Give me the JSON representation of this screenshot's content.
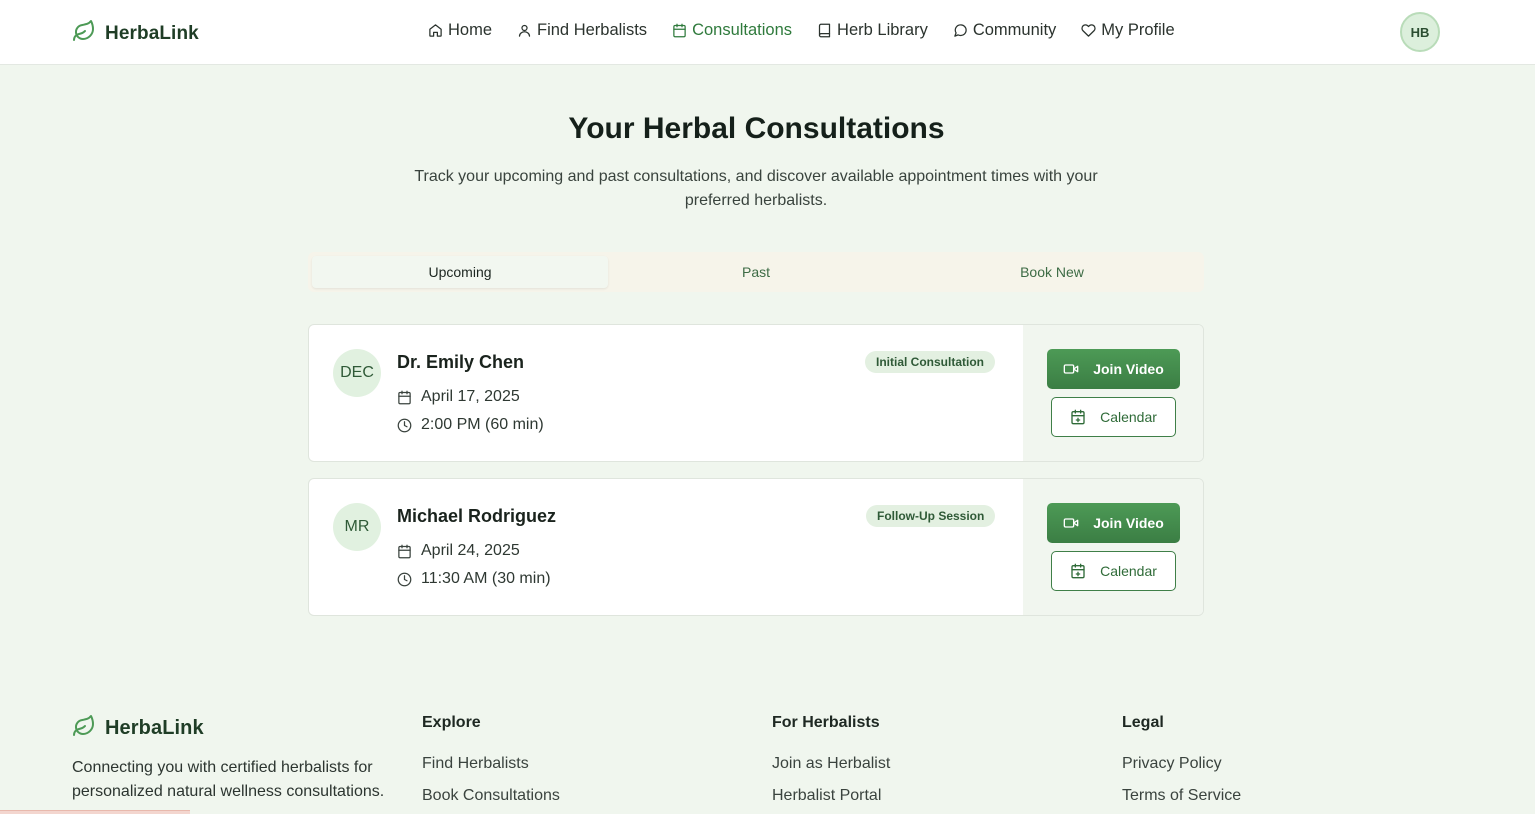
{
  "brand": {
    "name": "HerbaLink",
    "icon": "leaf-icon",
    "color": "#1f3d26",
    "accent": "#4d9a56"
  },
  "nav": {
    "items": [
      {
        "label": "Home",
        "icon": "home-icon",
        "active": false
      },
      {
        "label": "Find Herbalists",
        "icon": "user-icon",
        "active": false
      },
      {
        "label": "Consultations",
        "icon": "calendar-icon",
        "active": true
      },
      {
        "label": "Herb Library",
        "icon": "book-icon",
        "active": false
      },
      {
        "label": "Community",
        "icon": "chat-icon",
        "active": false
      },
      {
        "label": "My Profile",
        "icon": "heart-icon",
        "active": false
      }
    ]
  },
  "user": {
    "initials": "HB"
  },
  "page": {
    "title": "Your Herbal Consultations",
    "description": "Track your upcoming and past consultations, and discover available appointment times with your preferred herbalists."
  },
  "tabs": [
    {
      "label": "Upcoming",
      "active": true
    },
    {
      "label": "Past",
      "active": false
    },
    {
      "label": "Book New",
      "active": false
    }
  ],
  "consultations": [
    {
      "initials": "DEC",
      "name": "Dr. Emily Chen",
      "type": "Initial Consultation",
      "date": "April 17, 2025",
      "time": "2:00 PM (60 min)",
      "join_label": "Join Video",
      "calendar_label": "Calendar"
    },
    {
      "initials": "MR",
      "name": "Michael Rodriguez",
      "type": "Follow-Up Session",
      "date": "April 24, 2025",
      "time": "11:30 AM (30 min)",
      "join_label": "Join Video",
      "calendar_label": "Calendar"
    }
  ],
  "footer": {
    "brand": "HerbaLink",
    "tagline": "Connecting you with certified herbalists for personalized natural wellness consultations.",
    "columns": [
      {
        "heading": "Explore",
        "links": [
          "Find Herbalists",
          "Book Consultations"
        ]
      },
      {
        "heading": "For Herbalists",
        "links": [
          "Join as Herbalist",
          "Herbalist Portal"
        ]
      },
      {
        "heading": "Legal",
        "links": [
          "Privacy Policy",
          "Terms of Service"
        ]
      }
    ]
  }
}
